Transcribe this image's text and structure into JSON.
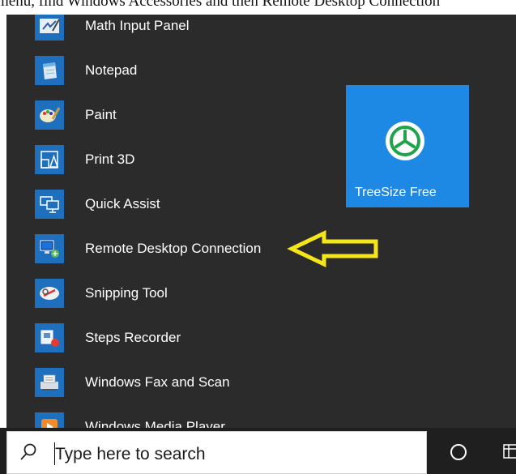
{
  "caption": {
    "text": "menu, find Windows Accessories and then Remote Desktop Connection"
  },
  "start_menu": {
    "apps": [
      {
        "label": "Math Input Panel",
        "icon": "math-input-panel-icon"
      },
      {
        "label": "Notepad",
        "icon": "notepad-icon"
      },
      {
        "label": "Paint",
        "icon": "paint-icon"
      },
      {
        "label": "Print 3D",
        "icon": "print-3d-icon"
      },
      {
        "label": "Quick Assist",
        "icon": "quick-assist-icon"
      },
      {
        "label": "Remote Desktop Connection",
        "icon": "remote-desktop-icon"
      },
      {
        "label": "Snipping Tool",
        "icon": "snipping-tool-icon"
      },
      {
        "label": "Steps Recorder",
        "icon": "steps-recorder-icon"
      },
      {
        "label": "Windows Fax and Scan",
        "icon": "fax-scan-icon"
      },
      {
        "label": "Windows Media Player",
        "icon": "media-player-icon"
      }
    ],
    "tile": {
      "label": "TreeSize Free",
      "icon": "treesize-icon"
    }
  },
  "annotation": {
    "icon": "arrow-left-icon",
    "color": "#f5e61a"
  },
  "taskbar": {
    "search_placeholder": "Type here to search",
    "icons": [
      "search-icon",
      "cortana-icon",
      "task-view-icon"
    ]
  },
  "colors": {
    "menu_bg": "#2b2b2b",
    "icon_blue": "#1f6fbf",
    "tile_blue": "#1e88e5",
    "taskbar_bg": "#1f1f1f"
  }
}
